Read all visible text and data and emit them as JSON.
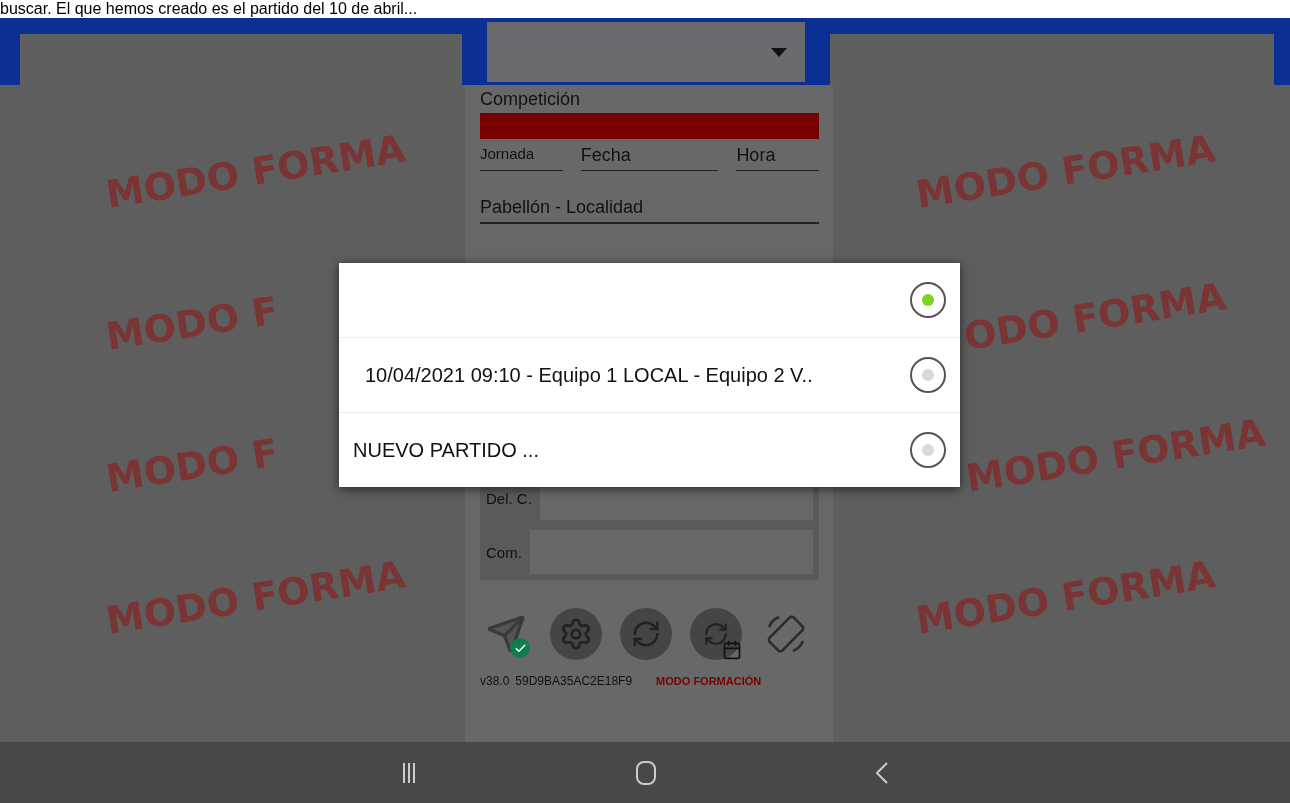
{
  "caption": "buscar. El que hemos creado es el partido del 10 de abril...",
  "form": {
    "competition_label": "Competición",
    "schedule_fields": [
      {
        "label": "Jornada"
      },
      {
        "label": "Fecha"
      },
      {
        "label": "Hora"
      }
    ],
    "venue_label": "Pabellón - Localidad",
    "officials": [
      {
        "label": "Del. C."
      },
      {
        "label": "Com."
      }
    ]
  },
  "footer": {
    "version": "v38.0",
    "device_id": "59D9BA35AC2E18F9",
    "mode": "MODO FORMACIÓN"
  },
  "watermarks": {
    "left": [
      "MODO FORMA",
      "MODO F",
      "MODO F",
      "MODO FORMA"
    ],
    "right": [
      "MODO FORMA",
      "ODO FORMA",
      "MODO FORMA",
      "MODO FORMA"
    ]
  },
  "dialog": {
    "options": [
      {
        "selected": true
      },
      {
        "label": "10/04/2021 09:10 - Equipo 1 LOCAL - Equipo 2 V..",
        "selected": false
      },
      {
        "label": "NUEVO PARTIDO ...",
        "selected": false
      }
    ]
  }
}
